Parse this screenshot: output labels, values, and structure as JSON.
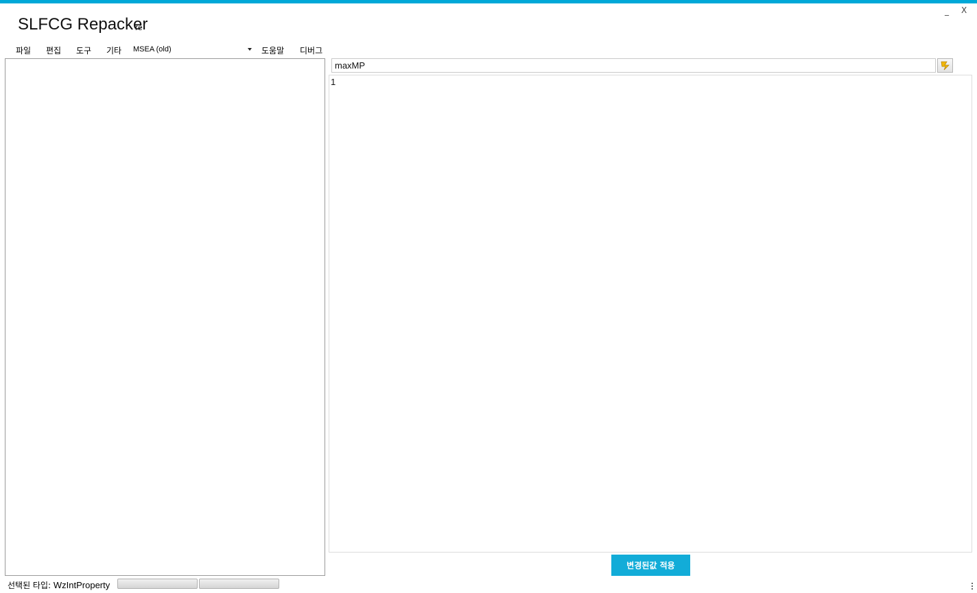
{
  "window": {
    "title": "SLFCG Repacker",
    "subtitle": "re",
    "minimize_label": "_",
    "close_label": "X",
    "accent_color": "#00a8d8"
  },
  "menu": {
    "file": "파일",
    "edit": "편집",
    "tools": "도구",
    "other": "기타",
    "version_select": "MSEA (old)",
    "help": "도움말",
    "debug": "디버그"
  },
  "editor": {
    "name_value": "maxMP",
    "value_text": "1",
    "action_icon": "lightning-icon",
    "apply_label": "변경된값 적용",
    "apply_color": "#12acd8"
  },
  "status": {
    "selected_type_label": "선택된 타입:",
    "selected_type_value": "WzIntProperty",
    "progress_1": 0,
    "progress_2": 0
  }
}
